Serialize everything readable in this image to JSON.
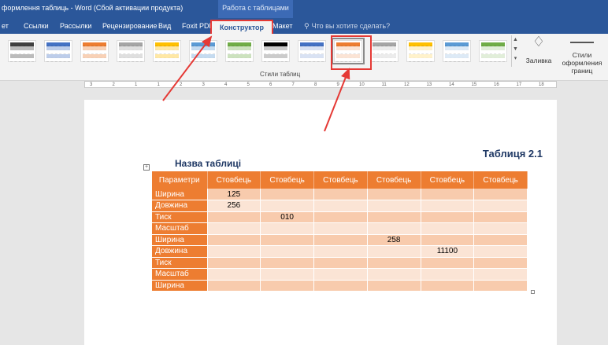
{
  "titlebar": {
    "doc_title": "формлення таблиць - Word (Сбой активации продукта)",
    "context_title": "Работа с таблицами"
  },
  "tabs": [
    {
      "label": "ет"
    },
    {
      "label": "Ссылки"
    },
    {
      "label": "Рассылки"
    },
    {
      "label": "Рецензирование"
    },
    {
      "label": "Вид"
    },
    {
      "label": "Foxit PDF"
    },
    {
      "label": "Конструктор",
      "active": true
    },
    {
      "label": "Макет"
    }
  ],
  "search": {
    "icon": "lightbulb-icon",
    "label": "Что вы хотите сделать?"
  },
  "ribbon": {
    "group_label": "Стили таблиц",
    "fill_label": "Заливка",
    "border_styles_label_1": "Стили оформления",
    "border_styles_label_2": "границ",
    "style_swatches": [
      "#404040",
      "#4472c4",
      "#ed7d31",
      "#a5a5a5",
      "#ffc000",
      "#5b9bd5",
      "#70ad47",
      "#000000",
      "#4472c4",
      "#ed7d31",
      "#a5a5a5",
      "#ffc000",
      "#5b9bd5",
      "#70ad47"
    ],
    "selected_swatch": 9
  },
  "ruler": {
    "marks": [
      "3",
      "2",
      "1",
      "1",
      "2",
      "3",
      "4",
      "5",
      "6",
      "7",
      "8",
      "9",
      "10",
      "11",
      "12",
      "13",
      "14",
      "15",
      "16",
      "17",
      "18"
    ]
  },
  "document": {
    "table_number": "Таблиця 2.1",
    "table_title": "Назва таблиці",
    "headers": [
      "Параметри",
      "Стовбець",
      "Стовбець",
      "Стовбець",
      "Стовбець",
      "Стовбець",
      "Стовбець"
    ],
    "rows": [
      [
        "Ширина",
        "125",
        "",
        "",
        "",
        "",
        ""
      ],
      [
        "Довжина",
        "256",
        "",
        "",
        "",
        "",
        ""
      ],
      [
        "Тиск",
        "",
        "010",
        "",
        "",
        "",
        ""
      ],
      [
        "Масштаб",
        "",
        "",
        "",
        "",
        "",
        ""
      ],
      [
        "Ширина",
        "",
        "",
        "",
        "258",
        "",
        ""
      ],
      [
        "Довжина",
        "",
        "",
        "",
        "",
        "11100",
        ""
      ],
      [
        "Тиск",
        "",
        "",
        "",
        "",
        "",
        ""
      ],
      [
        "Масштаб",
        "",
        "",
        "",
        "",
        "",
        ""
      ],
      [
        "Ширина",
        "",
        "",
        "",
        "",
        "",
        ""
      ]
    ]
  },
  "colors": {
    "accent": "#2b579a",
    "highlight": "#e53935",
    "table_header": "#ed7d31",
    "table_band_dark": "#f8cbad",
    "table_band_light": "#fbe4d5",
    "title_text": "#1f3864"
  }
}
